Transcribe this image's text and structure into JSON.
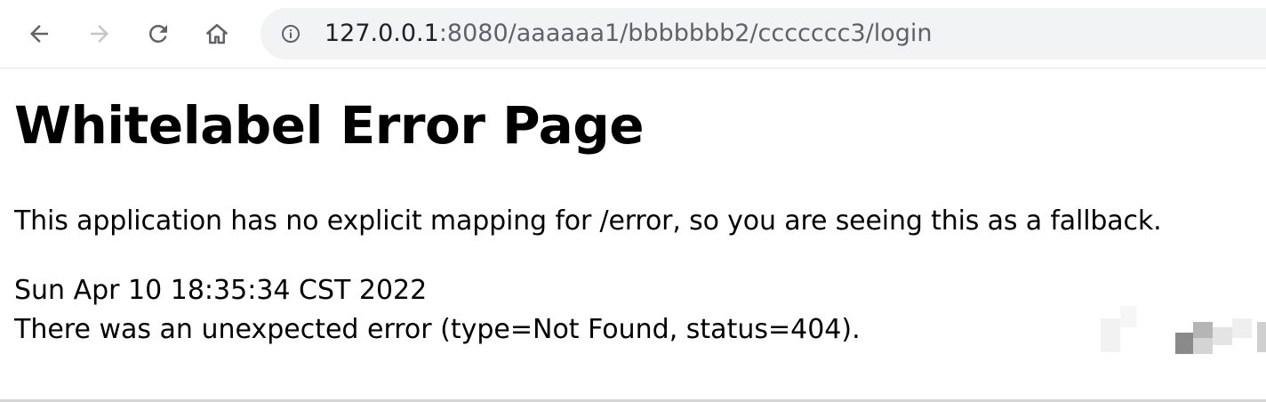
{
  "browser": {
    "address": {
      "host": "127.0.0.1",
      "rest": ":8080/aaaaaa1/bbbbbbb2/ccccccc3/login"
    },
    "icons": {
      "back": "back-arrow-icon",
      "forward": "forward-arrow-icon",
      "reload": "reload-icon",
      "home": "home-icon",
      "site_info": "info-icon"
    }
  },
  "page": {
    "title": "Whitelabel Error Page",
    "mapping_message": "This application has no explicit mapping for /error, so you are seeing this as a fallback.",
    "timestamp": "Sun Apr 10 18:35:34 CST 2022",
    "error_detail": "There was an unexpected error (type=Not Found, status=404)."
  },
  "colors": {
    "omnibox_bg": "#f1f3f4",
    "icon_active": "#5f6368",
    "icon_disabled": "#c4c7c5",
    "text": "#000000"
  }
}
